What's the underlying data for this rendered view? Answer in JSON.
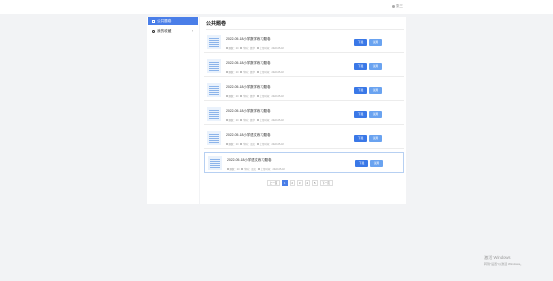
{
  "header": {
    "user_label": "张三"
  },
  "sidebar": {
    "items": [
      {
        "label": "公共题卷",
        "active": true
      },
      {
        "label": "我的收藏",
        "chevron": "›"
      }
    ]
  },
  "main": {
    "title": "公共题卷",
    "download_label": "下载",
    "preview_label": "试用",
    "cards": [
      {
        "title": "2022-05-18小学数学练习题卷",
        "meta": [
          "题数：20",
          "学科：数学",
          "上传时间：2022-05-18"
        ]
      },
      {
        "title": "2022-05-18小学数学练习题卷",
        "meta": [
          "题数：20",
          "学科：数学",
          "上传时间：2022-05-18"
        ]
      },
      {
        "title": "2022-05-18小学数学练习题卷",
        "meta": [
          "题数：20",
          "学科：数学",
          "上传时间：2022-05-18"
        ]
      },
      {
        "title": "2022-05-18小学数学练习题卷",
        "meta": [
          "题数：20",
          "学科：数学",
          "上传时间：2022-05-18"
        ]
      },
      {
        "title": "2022-05-18小学语文练习题卷",
        "meta": [
          "题数：20",
          "学科：语文",
          "上传时间：2022-05-18"
        ]
      },
      {
        "title": "2022-05-18小学语文练习题卷",
        "meta": [
          "题数：20",
          "学科：语文",
          "上传时间：2022-05-18"
        ]
      }
    ]
  },
  "pagination": {
    "prev": "上一页",
    "pages": [
      "1",
      "2",
      "3",
      "4",
      "5"
    ],
    "current": "1",
    "next": "下一页"
  },
  "watermark": {
    "line1": "激活 Windows",
    "line2": "转到\"设置\"以激活 Windows。"
  }
}
